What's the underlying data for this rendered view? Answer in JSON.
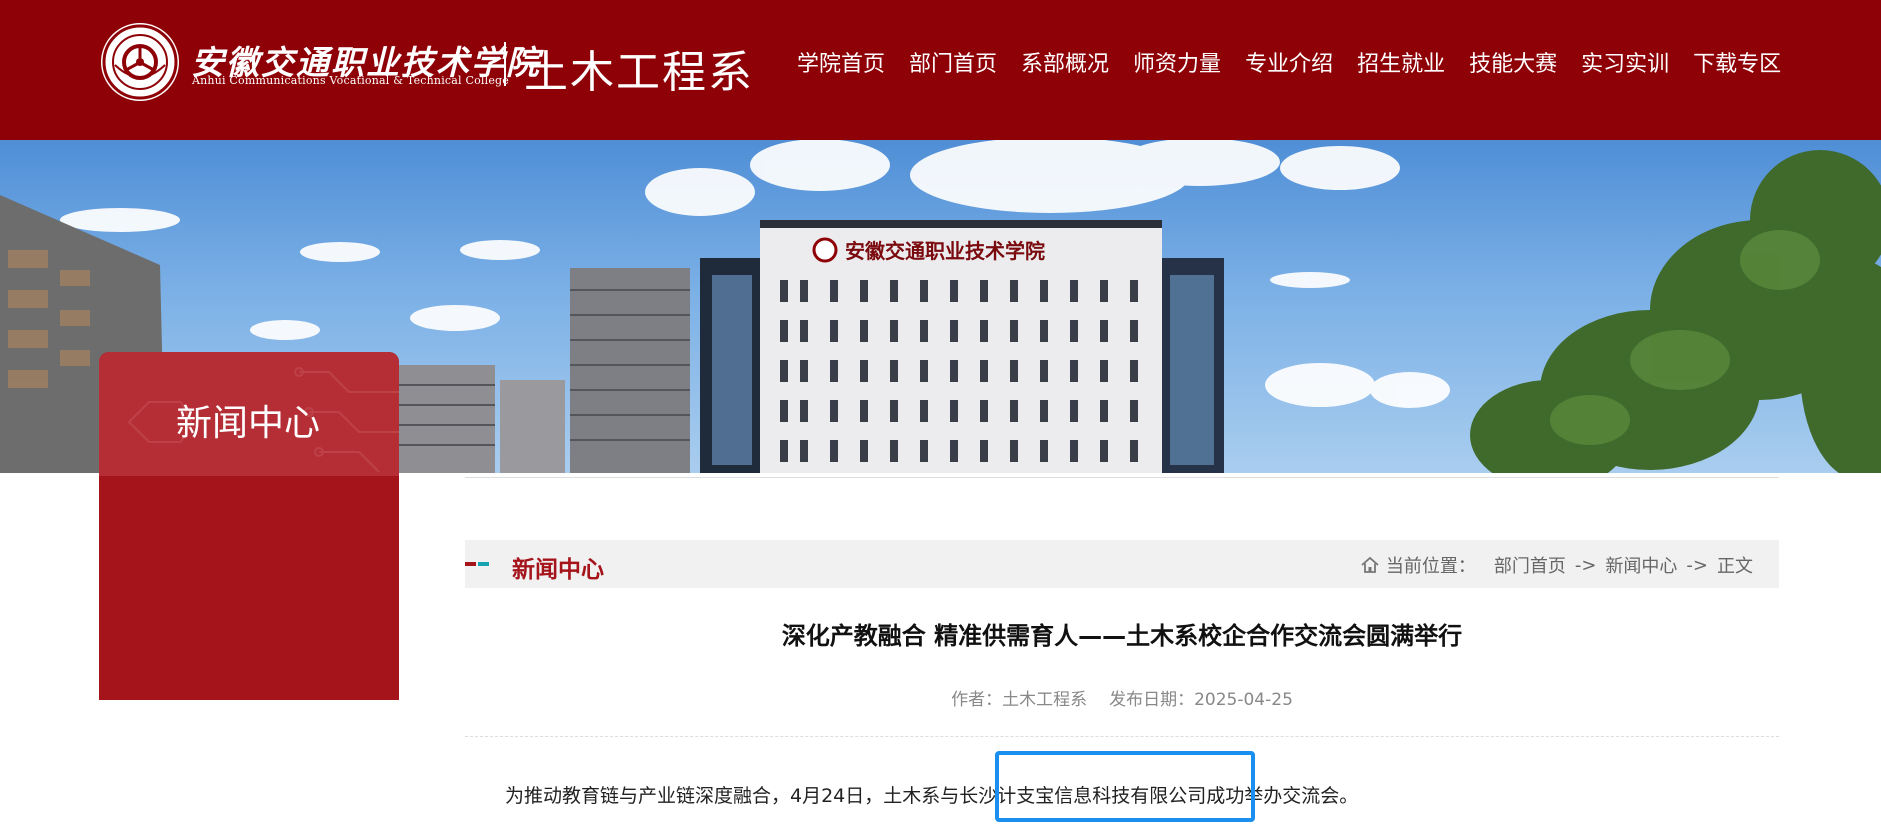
{
  "header": {
    "college_name_cn": "安徽交通职业技术学院",
    "college_name_en": "Anhui Communications Vocational & Technical College",
    "dept_name": "土木工程系",
    "nav": [
      "学院首页",
      "部门首页",
      "系部概况",
      "师资力量",
      "专业介绍",
      "招生就业",
      "技能大赛",
      "实习实训",
      "下载专区"
    ]
  },
  "banner": {
    "building_sign": "安徽交通职业技术学院"
  },
  "side_panel": {
    "title": "新闻中心"
  },
  "breadcrumb": {
    "section_title": "新闻中心",
    "location_label": "当前位置：",
    "items": [
      "部门首页",
      "新闻中心",
      "正文"
    ],
    "separator": "->"
  },
  "article": {
    "title": "深化产教融合 精准供需育人——土木系校企合作交流会圆满举行",
    "author": "作者：土木工程系",
    "date": "发布日期：2025-04-25",
    "first_paragraph": "为推动教育链与产业链深度融合，4月24日，土木系与长沙计支宝信息科技有限公司成功举办交流会。",
    "highlighted_text": "长沙计支宝信息科技有限公司"
  },
  "colors": {
    "header_red": "#8e0207",
    "panel_red": "#a5131b",
    "accent_teal": "#18a3b3",
    "highlight_blue": "#1a8ff0"
  }
}
